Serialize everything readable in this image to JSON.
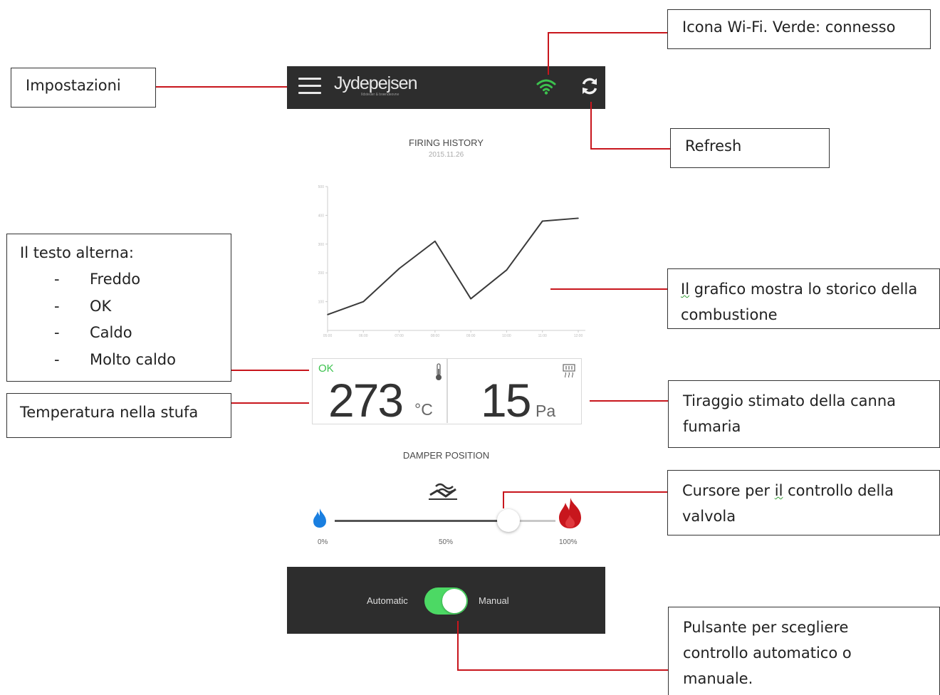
{
  "app": {
    "logo": "Jydepejsen",
    "logo_tagline": "Ildsteder & brændeovne",
    "wifi_color": "#3cc24e",
    "header_bg": "#2d2d2d"
  },
  "firing_history": {
    "title": "FIRING HISTORY",
    "date": "2015.11.26"
  },
  "chart_data": {
    "type": "line",
    "title": "FIRING HISTORY",
    "subtitle": "2015.11.26",
    "xlabel": "",
    "ylabel": "",
    "ylim": [
      0,
      500
    ],
    "y_ticks": [
      "100",
      "200",
      "300",
      "400",
      "500"
    ],
    "x_ticks": [
      "05:00",
      "06:00",
      "07:00",
      "08:00",
      "09:00",
      "10:00",
      "11:00",
      "12:00"
    ],
    "grid": false,
    "series": [
      {
        "values": [
          {
            "x": 0.0,
            "y": 55
          },
          {
            "x": 1.0,
            "y": 100
          },
          {
            "x": 2.0,
            "y": 215
          },
          {
            "x": 3.0,
            "y": 310
          },
          {
            "x": 4.0,
            "y": 110
          },
          {
            "x": 5.0,
            "y": 210
          },
          {
            "x": 6.0,
            "y": 380
          },
          {
            "x": 7.0,
            "y": 390
          }
        ]
      }
    ]
  },
  "readings": {
    "status": "OK",
    "status_color": "#3cc24e",
    "temperature": "273",
    "temperature_unit": "°C",
    "draft": "15",
    "draft_unit": "Pa"
  },
  "damper": {
    "title": "DAMPER POSITION",
    "position_percent": 75,
    "tick_min": "0%",
    "tick_mid": "50%",
    "tick_max": "100%"
  },
  "mode": {
    "automatic_label": "Automatic",
    "manual_label": "Manual",
    "toggle_on": true,
    "toggle_color": "#4cd964"
  },
  "annotations": {
    "settings": "Impostazioni",
    "wifi": "Icona Wi-Fi. Verde: connesso",
    "refresh": "Refresh",
    "status_title": "Il testo alterna:",
    "status_items": [
      "Freddo",
      "OK",
      "Caldo",
      "Molto caldo"
    ],
    "chart_line1_word": "Il",
    "chart_line1_rest": " grafico mostra lo storico della",
    "chart_line2": "combustione",
    "temperature": "Temperatura nella stufa",
    "draft_line1": "Tiraggio stimato della canna",
    "draft_line2": "fumaria",
    "slider_line1_a": "Cursore per ",
    "slider_line1_word": "il",
    "slider_line1_b": " controllo della",
    "slider_line2": "valvola",
    "toggle_line1": "Pulsante per scegliere",
    "toggle_line2": "controllo automatico o",
    "toggle_line3": "manuale."
  }
}
